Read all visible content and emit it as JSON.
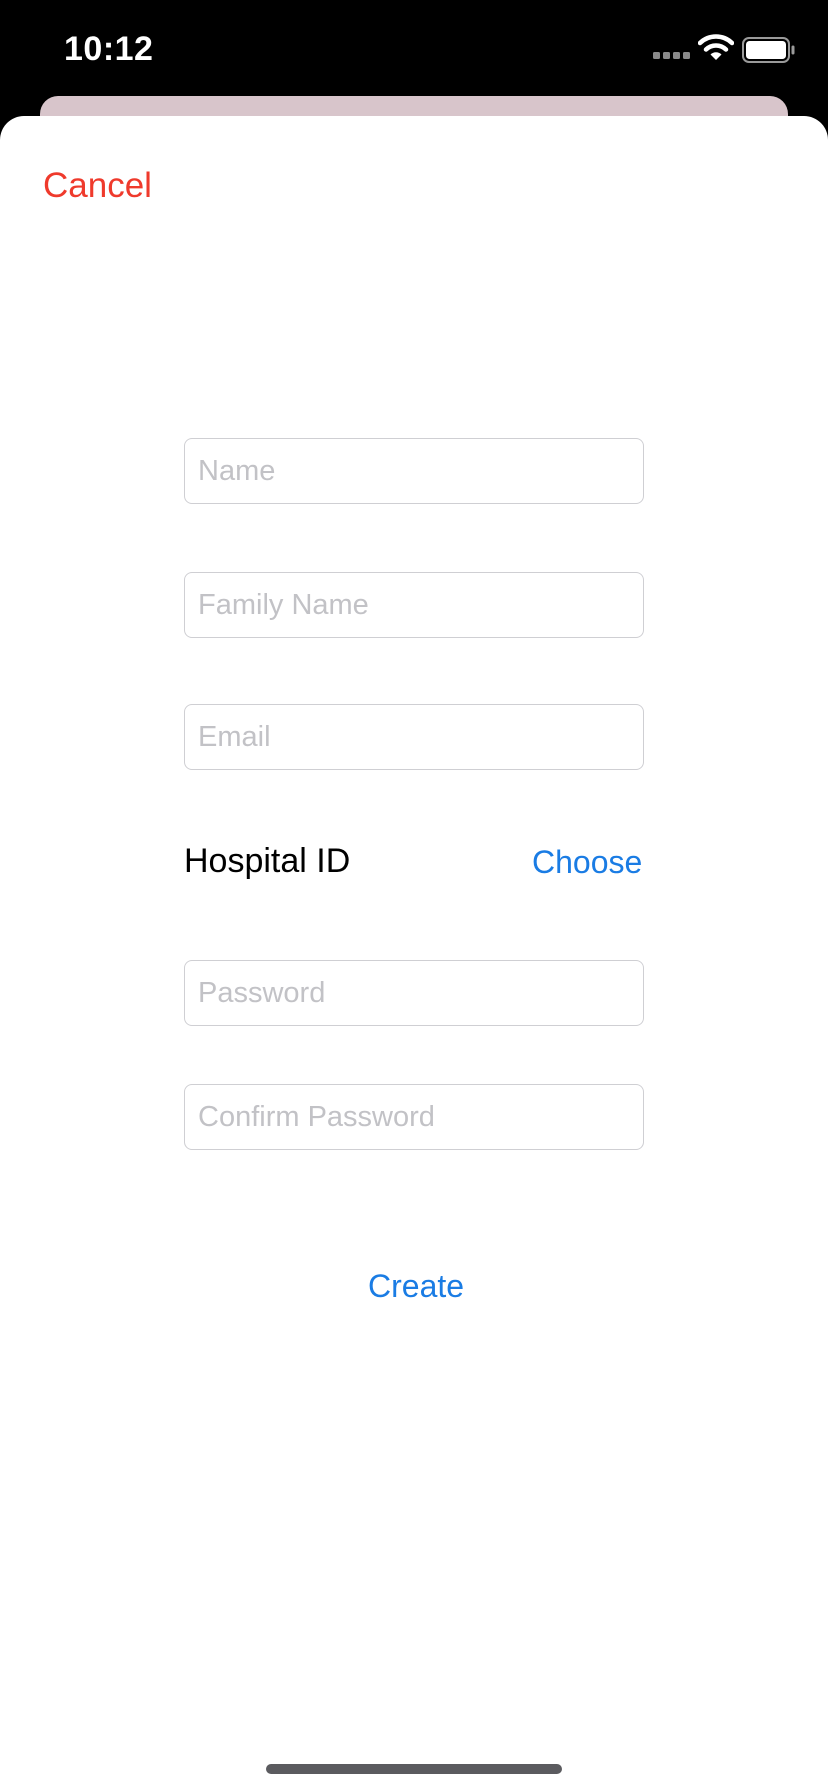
{
  "status_bar": {
    "time": "10:12",
    "icons": [
      "signal-icon",
      "wifi-icon",
      "battery-icon"
    ]
  },
  "nav": {
    "cancel_label": "Cancel"
  },
  "form": {
    "name_placeholder": "Name",
    "family_name_placeholder": "Family Name",
    "email_placeholder": "Email",
    "hospital_label": "Hospital ID",
    "choose_label": "Choose",
    "password_placeholder": "Password",
    "confirm_password_placeholder": "Confirm Password",
    "create_label": "Create"
  },
  "colors": {
    "cancel": "#ef3a2c",
    "accent": "#1a7ce4",
    "placeholder": "#c2c2c6"
  }
}
